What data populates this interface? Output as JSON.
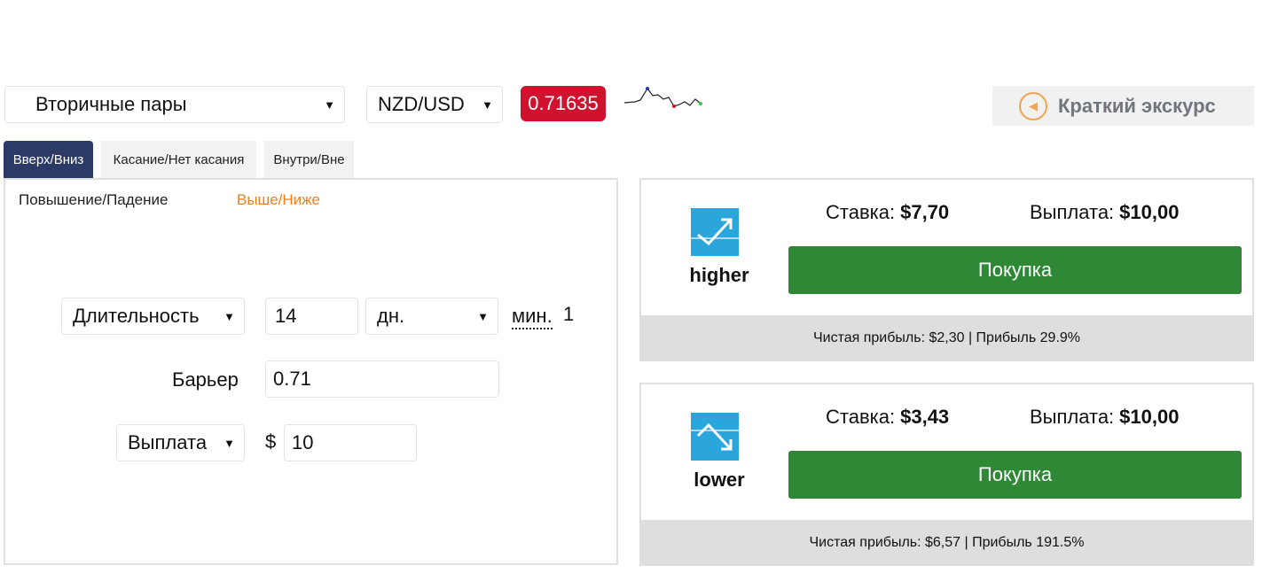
{
  "top_bar": {
    "market": "Вторичные пары",
    "asset": "NZD/USD",
    "spot_price": "0.71635",
    "tour_label": "Краткий экскурс"
  },
  "colors": {
    "spot_bg": "#d0122f",
    "active_tab": "#2b3a66",
    "accent_orange": "#e98024",
    "buy_green": "#2e8836",
    "icon_blue": "#2aa6dc"
  },
  "tabs": [
    {
      "label": "Вверх/Вниз",
      "active": true
    },
    {
      "label": "Касание/Нет касания",
      "active": false
    },
    {
      "label": "Внутри/Вне",
      "active": false
    }
  ],
  "subtabs": [
    {
      "label": "Повышение/Падение",
      "active": false
    },
    {
      "label": "Выше/Ниже",
      "active": true
    }
  ],
  "form": {
    "duration_type": "Длительность",
    "duration_value": "14",
    "duration_unit": "дн.",
    "min_label": "мин.",
    "min_value": "1",
    "barrier_label": "Барьер",
    "barrier_value": "0.71",
    "amount_type": "Выплата",
    "currency_symbol": "$",
    "amount_value": "10"
  },
  "contracts": [
    {
      "label": "higher",
      "stake_label": "Ставка:",
      "stake_value": "$7,70",
      "payout_label": "Выплата:",
      "payout_value": "$10,00",
      "buy_label": "Покупка",
      "footer": "Чистая прибыль: $2,30 | Прибыль 29.9%"
    },
    {
      "label": "lower",
      "stake_label": "Ставка:",
      "stake_value": "$3,43",
      "payout_label": "Выплата:",
      "payout_value": "$10,00",
      "buy_label": "Покупка",
      "footer": "Чистая прибыль: $6,57 | Прибыль 191.5%"
    }
  ],
  "icons": [
    "dropdown-arrow-icon",
    "tour-arrow-icon",
    "rise-chart-icon",
    "fall-chart-icon",
    "sparkline-chart"
  ]
}
